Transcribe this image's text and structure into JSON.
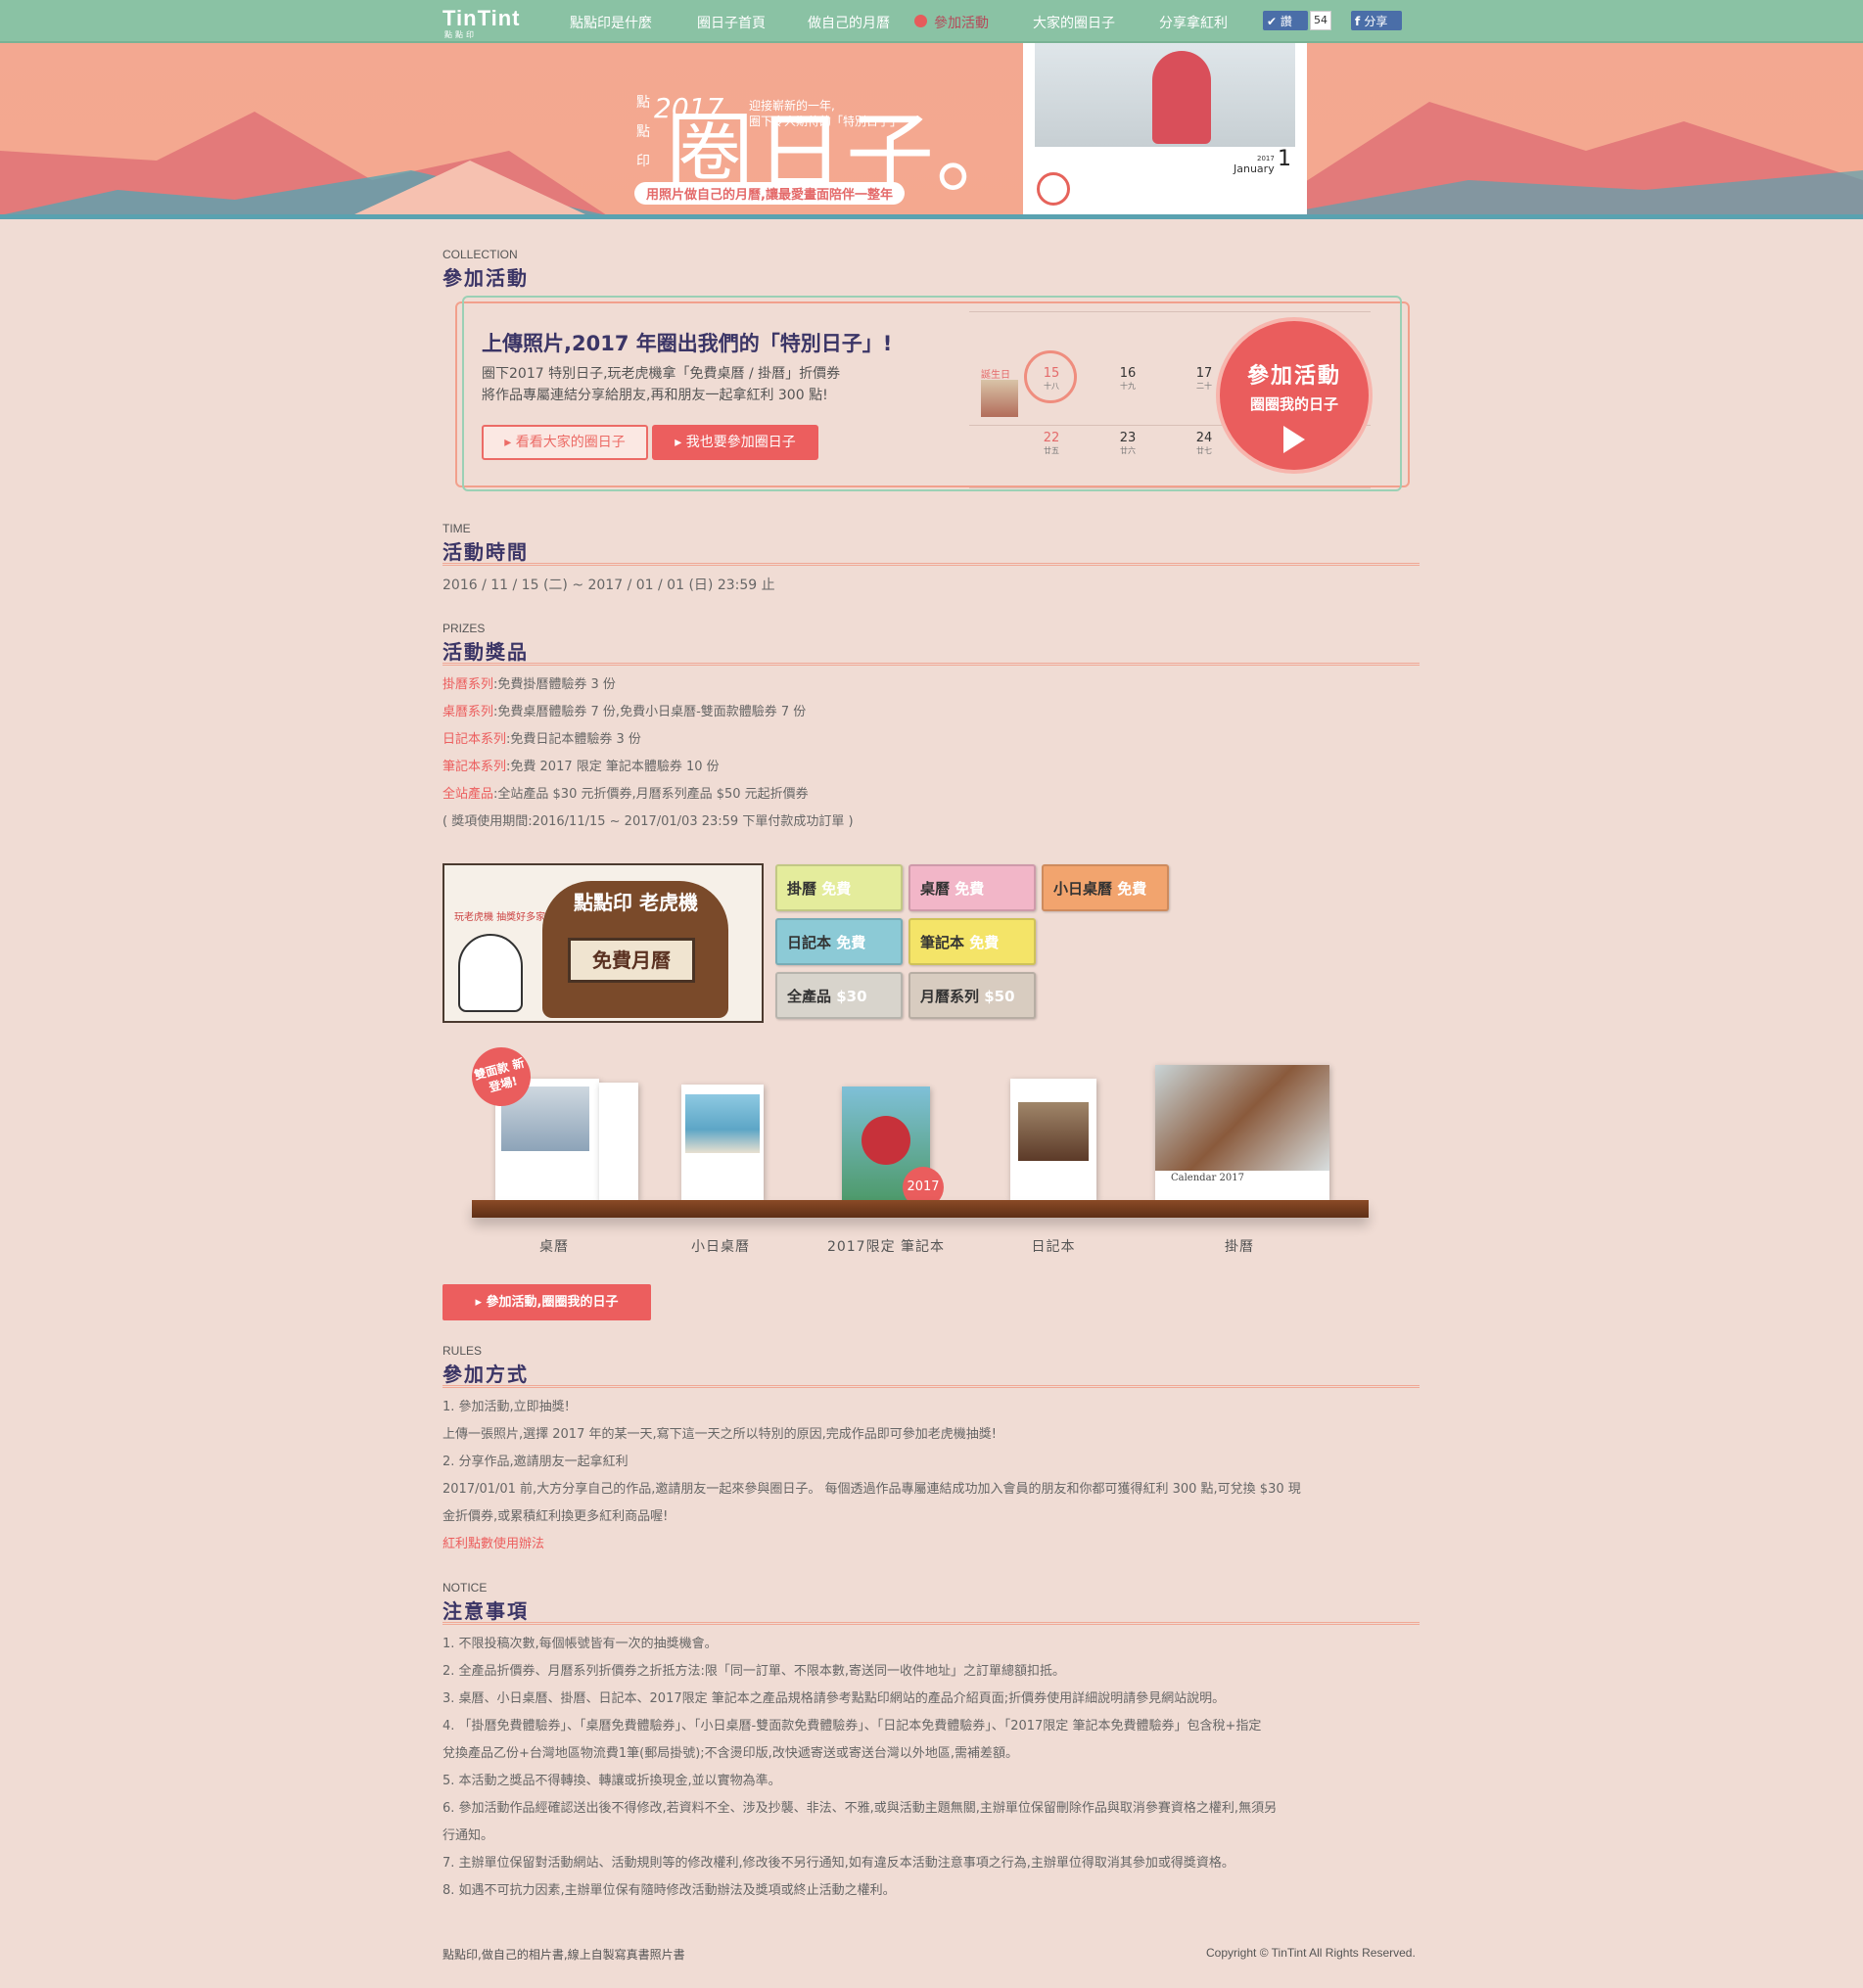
{
  "nav": {
    "logo": "TinTint",
    "logo_sub": "點點印",
    "items": [
      "點點印是什麼",
      "圈日子首頁",
      "做自己的月曆",
      "參加活動",
      "大家的圈日子",
      "分享拿紅利"
    ],
    "like_label": "讚",
    "like_count": "54",
    "share_label": "分享"
  },
  "banner": {
    "year": "2017",
    "tagline_1": "迎接嶄新的一年,",
    "tagline_2": "圈下令人期待的「特別日子」",
    "brand_vertical": "點點印",
    "title": "圈日子。",
    "pill": "用照片做自己的月曆,讓最愛畫面陪伴一整年",
    "month": "January",
    "month_year": "2017",
    "month_num": "1"
  },
  "collection": {
    "en": "COLLECTION",
    "title": "參加活動"
  },
  "promo": {
    "heading": "上傳照片,2017 年圈出我們的「特別日子」!",
    "line1": "圈下2017 特別日子,玩老虎機拿「免費桌曆 / 掛曆」折價券",
    "line2": "將作品專屬連結分享給朋友,再和朋友一起拿紅利 300 點!",
    "btn_outline": "看看大家的圈日子",
    "btn_fill": "我也要參加圈日子",
    "bday": "誕生日",
    "cal_top": [
      {
        "n": "15",
        "l": "十八"
      },
      {
        "n": "16",
        "l": "十九"
      },
      {
        "n": "17",
        "l": "二十"
      }
    ],
    "cal_bottom": [
      {
        "n": "22",
        "l": "廿五"
      },
      {
        "n": "23",
        "l": "廿六"
      },
      {
        "n": "24",
        "l": "廿七"
      }
    ],
    "circle_a": "參加活動",
    "circle_b": "圈圈我的日子"
  },
  "time": {
    "en": "TIME",
    "title": "活動時間",
    "text": "2016 / 11 / 15 (二) ~ 2017 / 01 / 01 (日) 23:59 止"
  },
  "prizes": {
    "en": "PRIZES",
    "title": "活動獎品",
    "items": [
      {
        "k": "掛曆系列",
        "v": ":免費掛曆體驗券 3 份"
      },
      {
        "k": "桌曆系列",
        "v": ":免費桌曆體驗券 7 份,免費小日桌曆-雙面款體驗券 7 份"
      },
      {
        "k": "日記本系列",
        "v": ":免費日記本體驗券 3 份"
      },
      {
        "k": "筆記本系列",
        "v": ":免費 2017 限定 筆記本體驗券 10 份"
      },
      {
        "k": "全站產品",
        "v": ":全站產品 $30 元折價券,月曆系列產品 $50 元起折價券"
      }
    ],
    "note": "( 獎項使用期間:2016/11/15 ~ 2017/01/03 23:59 下單付款成功訂單 )"
  },
  "slot": {
    "title": "點點印 老虎機",
    "window": "免費月曆",
    "side": "玩老虎機 抽獎好多家!"
  },
  "tickets": [
    {
      "a": "掛曆",
      "b": "免費",
      "color": "#e4ec9c"
    },
    {
      "a": "桌曆",
      "b": "免費",
      "color": "#f2b6c8"
    },
    {
      "a": "小日桌曆",
      "b": "免費",
      "color": "#f2a46e"
    },
    {
      "a": "日記本",
      "b": "免費",
      "color": "#8ccad6"
    },
    {
      "a": "筆記本",
      "b": "免費",
      "color": "#f4e468"
    },
    {
      "a": "全產品",
      "b": "$30",
      "color": "#d8d4cc"
    },
    {
      "a": "月曆系列",
      "b": "$50",
      "color": "#d8ccc0"
    }
  ],
  "products": {
    "badge": "雙面款 新登場!",
    "badge2017": "2017",
    "labels": [
      "桌曆",
      "小日桌曆",
      "2017限定 筆記本",
      "日記本",
      "掛曆"
    ],
    "calendar_caption": "Calendar 2017"
  },
  "join_btn": "參加活動,圈圈我的日子",
  "rules": {
    "en": "RULES",
    "title": "參加方式",
    "lines": [
      "1. 參加活動,立即抽獎!",
      "上傳一張照片,選擇 2017 年的某一天,寫下這一天之所以特別的原因,完成作品即可參加老虎機抽獎!",
      "2. 分享作品,邀請朋友一起拿紅利",
      "2017/01/01 前,大方分享自己的作品,邀請朋友一起來參與圈日子。 每個透過作品專屬連結成功加入會員的朋友和你都可獲得紅利 300 點,可兌換 $30 現",
      "金折價券,或累積紅利換更多紅利商品喔!"
    ],
    "link": "紅利點數使用辦法"
  },
  "notice": {
    "en": "NOTICE",
    "title": "注意事項",
    "lines": [
      "1. 不限投稿次數,每個帳號皆有一次的抽獎機會。",
      "2. 全產品折價券、月曆系列折價券之折抵方法:限「同一訂單、不限本數,寄送同一收件地址」之訂單總額扣抵。",
      "3. 桌曆、小日桌曆、掛曆、日記本、2017限定 筆記本之產品規格請參考點點印網站的產品介紹頁面;折價券使用詳細說明請參見網站說明。",
      "4. 「掛曆免費體驗券」、「桌曆免費體驗券」、「小日桌曆-雙面款免費體驗券」、「日記本免費體驗券」、「2017限定 筆記本免費體驗券」包含稅+指定",
      "兌換產品乙份+台灣地區物流費1筆(郵局掛號);不含燙印版,改快遞寄送或寄送台灣以外地區,需補差額。",
      "5. 本活動之獎品不得轉換、轉讓或折換現金,並以實物為準。",
      "6. 參加活動作品經確認送出後不得修改,若資料不全、涉及抄襲、非法、不雅,或與活動主題無關,主辦單位保留刪除作品與取消參賽資格之權利,無須另",
      "行通知。",
      "7. 主辦單位保留對活動網站、活動規則等的修改權利,修改後不另行通知,如有違反本活動注意事項之行為,主辦單位得取消其參加或得獎資格。",
      "8. 如遇不可抗力因素,主辦單位保有隨時修改活動辦法及獎項或終止活動之權利。"
    ]
  },
  "footer": {
    "left": "點點印,做自己的相片書,線上自製寫真書照片書",
    "right": "Copyright © TinTint All Rights Reserved."
  }
}
